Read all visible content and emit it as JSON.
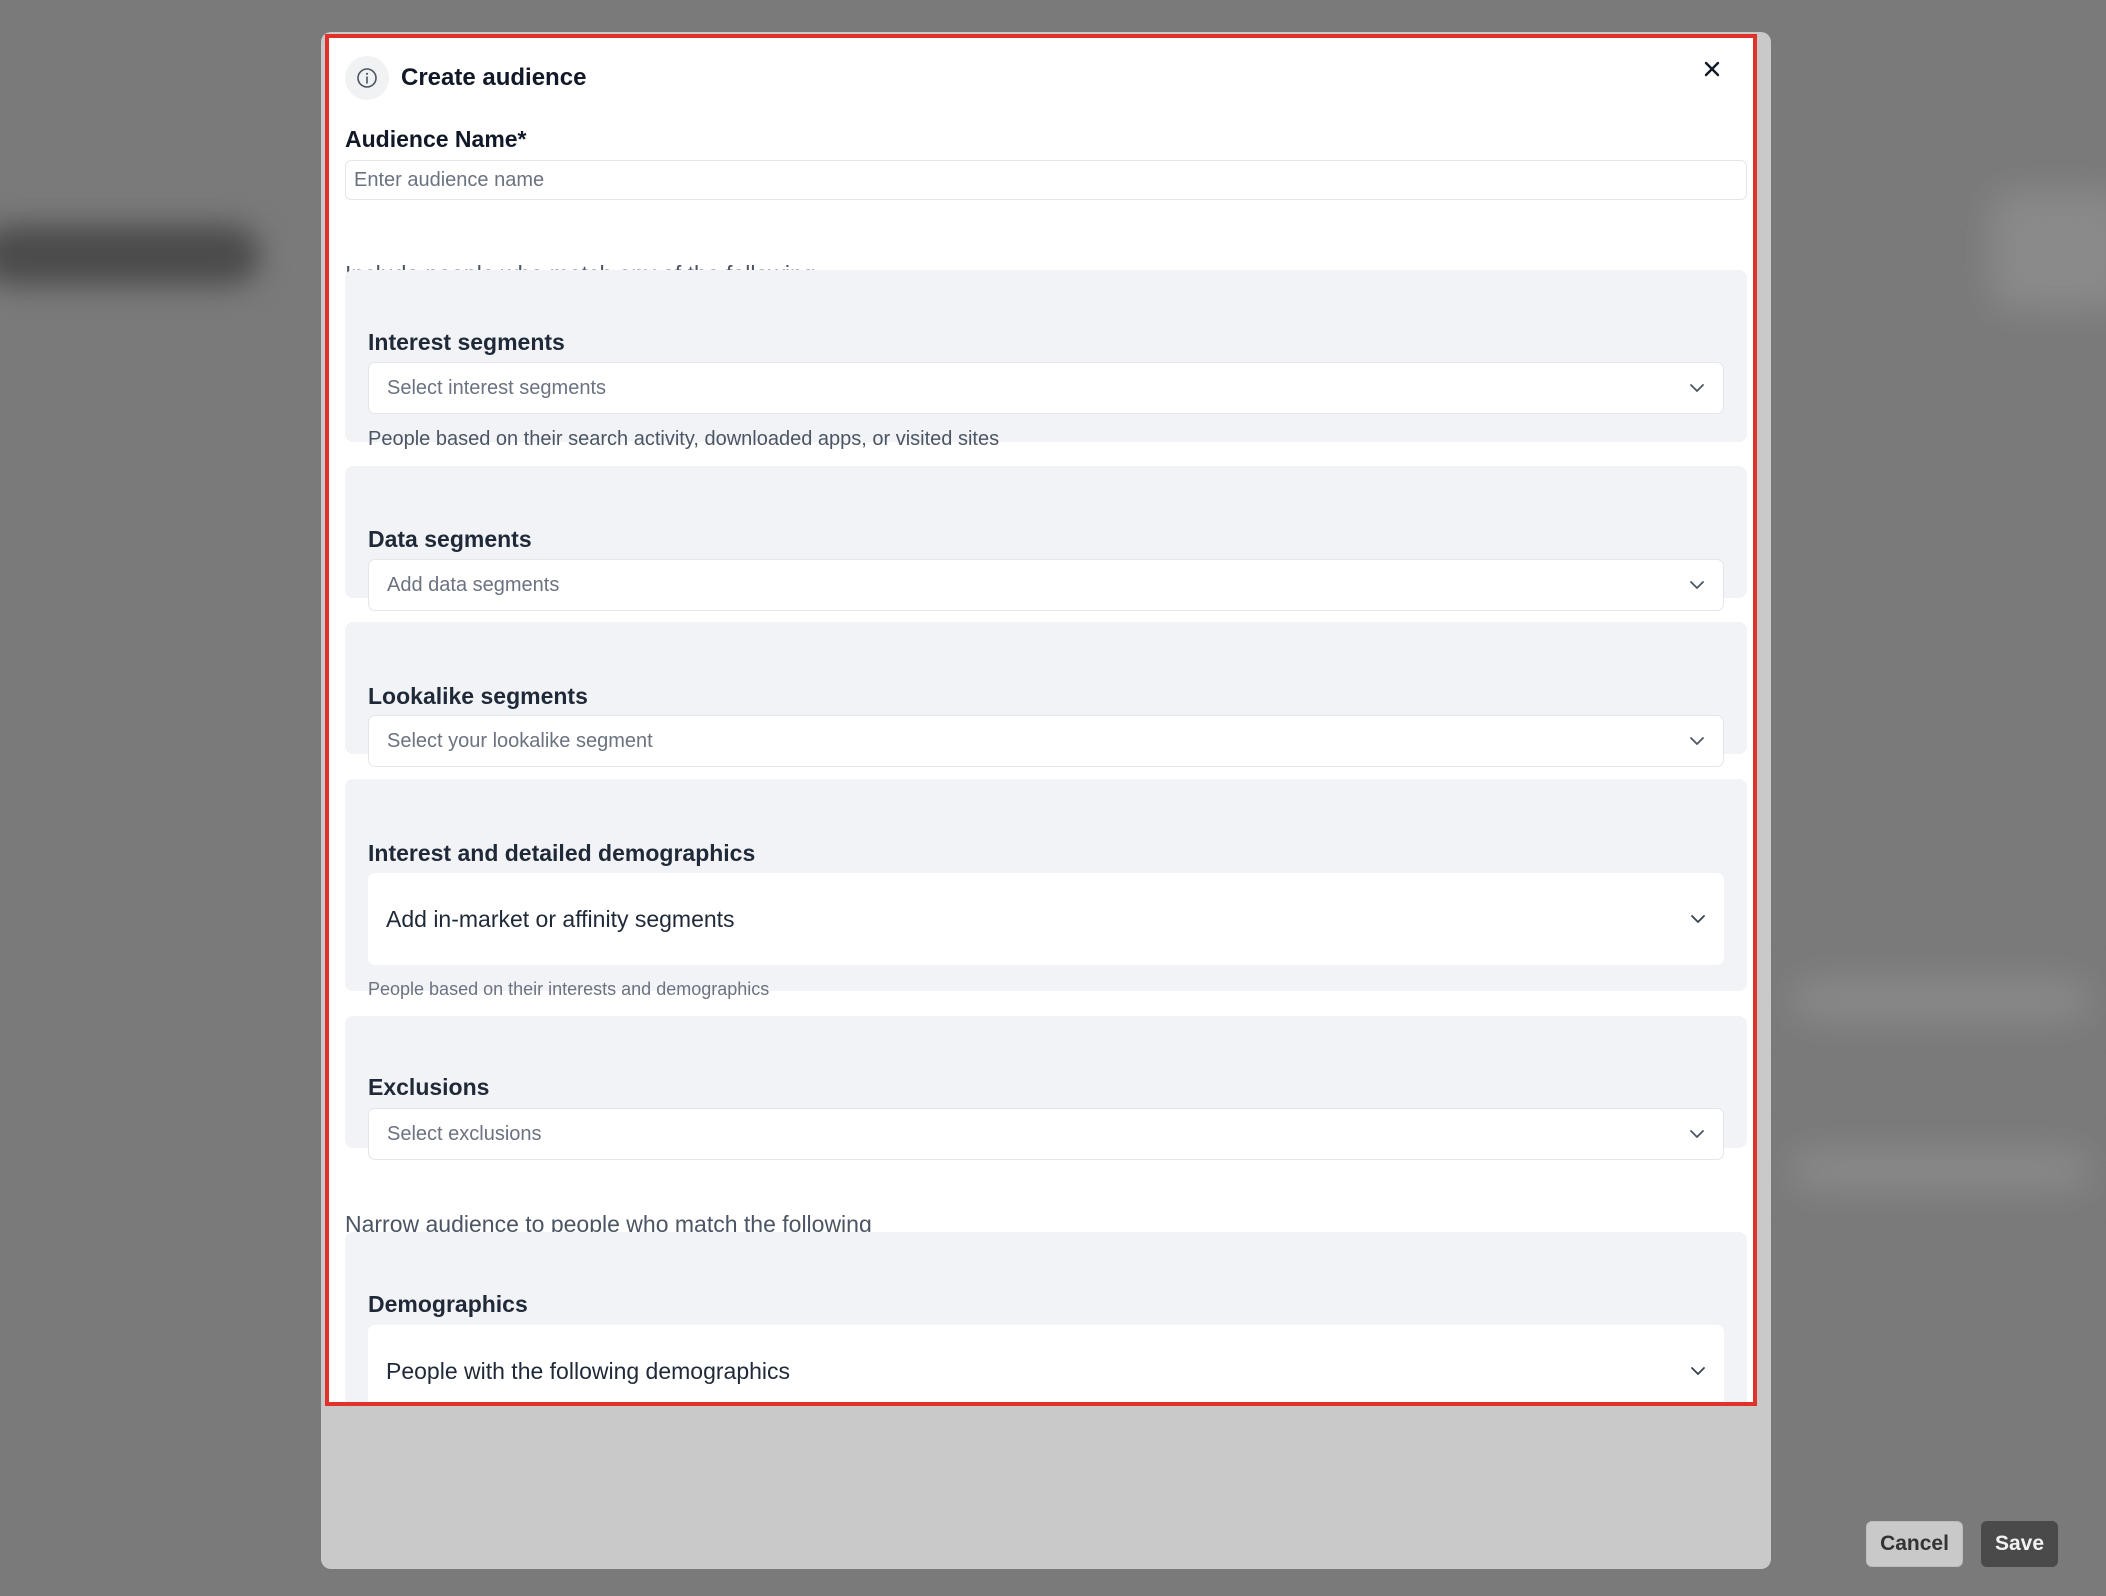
{
  "modal": {
    "title": "Create audience",
    "name_field": {
      "label": "Audience Name*",
      "placeholder": "Enter audience name",
      "value": ""
    },
    "include_intro": "Include people who match any of the following",
    "narrow_intro": "Narrow audience to people who match the following",
    "sections": {
      "interest_segments": {
        "title": "Interest segments",
        "placeholder": "Select interest segments",
        "help": "People based on their search activity, downloaded apps, or visited sites"
      },
      "data_segments": {
        "title": "Data segments",
        "placeholder": "Add data segments"
      },
      "lookalike_segments": {
        "title": "Lookalike segments",
        "placeholder": "Select your lookalike segment"
      },
      "interest_demographics": {
        "title": "Interest and detailed demographics",
        "dropdown_label": "Add in-market or affinity segments",
        "help": "People based on their interests and demographics"
      },
      "exclusions": {
        "title": "Exclusions",
        "placeholder": "Select exclusions"
      },
      "demographics": {
        "title": "Demographics",
        "dropdown_label": "People with the following demographics"
      }
    },
    "footer": {
      "cancel_label": "Cancel",
      "save_label": "Save"
    }
  },
  "icons": {
    "header": "info-icon",
    "close": "close-icon",
    "dropdown": "chevron-down-icon"
  },
  "colors": {
    "highlight_border": "#e0312a",
    "card_background": "#f2f3f6",
    "save_button": "#4a4a4a",
    "overlay": "#7a7a7a"
  }
}
